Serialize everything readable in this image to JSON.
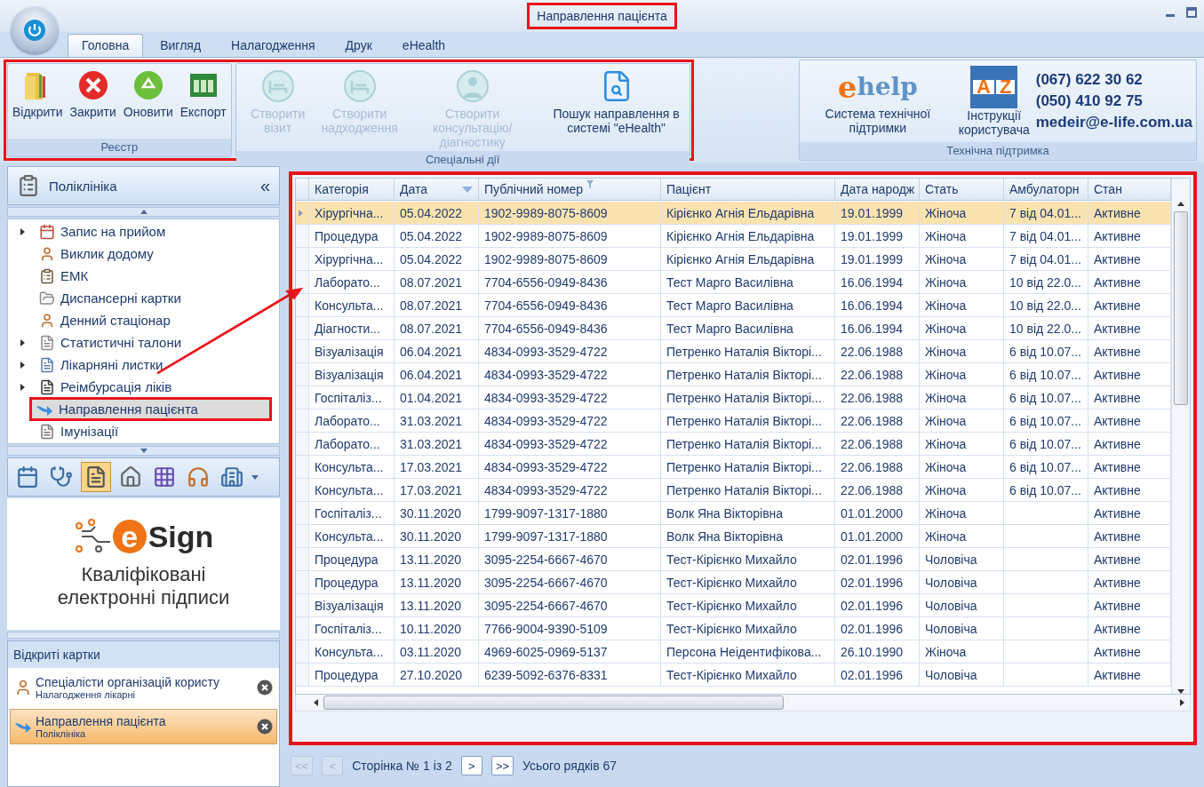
{
  "window": {
    "title": "Направлення пацієнта",
    "title_highlighted": true
  },
  "tabs": [
    {
      "label": "Головна",
      "selected": true
    },
    {
      "label": "Вигляд",
      "selected": false
    },
    {
      "label": "Налагодження",
      "selected": false
    },
    {
      "label": "Друк",
      "selected": false
    },
    {
      "label": "eHealth",
      "selected": false
    }
  ],
  "ribbon": {
    "highlighted": true,
    "groups": [
      {
        "title": "Реєстр",
        "buttons": [
          {
            "label": "Відкрити",
            "disabled": false
          },
          {
            "label": "Закрити",
            "disabled": false
          },
          {
            "label": "Оновити",
            "disabled": false
          },
          {
            "label": "Експорт",
            "disabled": false
          }
        ]
      },
      {
        "title": "Спеціальні дії",
        "buttons": [
          {
            "label": "Створити візит",
            "disabled": true
          },
          {
            "label": "Створити надходження",
            "disabled": true
          },
          {
            "label": "Створити консультацію/діагностику",
            "disabled": true
          },
          {
            "label": "Пошук направлення в системі \"eHealth\"",
            "disabled": false
          }
        ]
      }
    ]
  },
  "support": {
    "title": "Технічна підтримка",
    "help_logo": {
      "mark": "e",
      "text": "help"
    },
    "help_label": "Система технічної підтримки",
    "manual_letters": [
      "A",
      "Z"
    ],
    "manual_label": "Інструкції користувача",
    "phones": [
      "(067) 622 30 62",
      "(050) 410 92 75"
    ],
    "email": "medeir@e-life.com.ua"
  },
  "sidebar": {
    "title": "Поліклініка",
    "collapse": "«",
    "items": [
      {
        "label": "Запис на прийом",
        "has_children": true,
        "selected": false
      },
      {
        "label": "Виклик додому",
        "has_children": false,
        "selected": false
      },
      {
        "label": "ЕМК",
        "has_children": false,
        "selected": false
      },
      {
        "label": "Диспансерні картки",
        "has_children": false,
        "selected": false
      },
      {
        "label": "Денний стаціонар",
        "has_children": false,
        "selected": false
      },
      {
        "label": "Статистичні талони",
        "has_children": true,
        "selected": false
      },
      {
        "label": "Лікарняні листки",
        "has_children": true,
        "selected": false
      },
      {
        "label": "Реімбурсація ліків",
        "has_children": true,
        "selected": false
      },
      {
        "label": "Направлення пацієнта",
        "has_children": false,
        "selected": true,
        "highlighted": true
      },
      {
        "label": "Імунізації",
        "has_children": false,
        "selected": false
      }
    ],
    "modules": [
      {
        "selected": false
      },
      {
        "selected": false
      },
      {
        "selected": true
      },
      {
        "selected": false
      },
      {
        "selected": false
      },
      {
        "selected": false
      },
      {
        "selected": false
      }
    ]
  },
  "banner": {
    "logo": "Sign",
    "logo_mark": "e",
    "caption": "Кваліфіковані електронні підписи"
  },
  "open_cards": {
    "title": "Відкриті картки",
    "items": [
      {
        "title": "Спеціалісти організацій користу",
        "subtitle": "Налагодження лікарні",
        "selected": false
      },
      {
        "title": "Направлення пацієнта",
        "subtitle": "Поліклініка",
        "selected": true
      }
    ]
  },
  "table": {
    "highlighted": true,
    "columns": [
      {
        "label": "Категорія"
      },
      {
        "label": "Дата",
        "sorted": true
      },
      {
        "label": "Публічний номер",
        "filtered": true
      },
      {
        "label": "Пацієнт"
      },
      {
        "label": "Дата народж"
      },
      {
        "label": "Стать"
      },
      {
        "label": "Амбулаторн"
      },
      {
        "label": "Стан"
      }
    ],
    "rows": [
      {
        "selected": true,
        "cells": [
          "Хірургічна...",
          "05.04.2022",
          "1902-9989-8075-8609",
          "Кірієнко Агнія Ельдарівна",
          "19.01.1999",
          "Жіноча",
          "7 від 04.01...",
          "Активне"
        ]
      },
      {
        "selected": false,
        "cells": [
          "Процедура",
          "05.04.2022",
          "1902-9989-8075-8609",
          "Кірієнко Агнія Ельдарівна",
          "19.01.1999",
          "Жіноча",
          "7 від 04.01...",
          "Активне"
        ]
      },
      {
        "selected": false,
        "cells": [
          "Хірургічна...",
          "05.04.2022",
          "1902-9989-8075-8609",
          "Кірієнко Агнія Ельдарівна",
          "19.01.1999",
          "Жіноча",
          "7 від 04.01...",
          "Активне"
        ]
      },
      {
        "selected": false,
        "cells": [
          "Лаборато...",
          "08.07.2021",
          "7704-6556-0949-8436",
          "Тест Марго Василівна",
          "16.06.1994",
          "Жіноча",
          "10 від 22.0...",
          "Активне"
        ]
      },
      {
        "selected": false,
        "cells": [
          "Консульта...",
          "08.07.2021",
          "7704-6556-0949-8436",
          "Тест Марго Василівна",
          "16.06.1994",
          "Жіноча",
          "10 від 22.0...",
          "Активне"
        ]
      },
      {
        "selected": false,
        "cells": [
          "Діагности...",
          "08.07.2021",
          "7704-6556-0949-8436",
          "Тест Марго Василівна",
          "16.06.1994",
          "Жіноча",
          "10 від 22.0...",
          "Активне"
        ]
      },
      {
        "selected": false,
        "cells": [
          "Візуалізація",
          "06.04.2021",
          "4834-0993-3529-4722",
          "Петренко Наталія Вікторі...",
          "22.06.1988",
          "Жіноча",
          "6 від 10.07...",
          "Активне"
        ]
      },
      {
        "selected": false,
        "cells": [
          "Візуалізація",
          "06.04.2021",
          "4834-0993-3529-4722",
          "Петренко Наталія Вікторі...",
          "22.06.1988",
          "Жіноча",
          "6 від 10.07...",
          "Активне"
        ]
      },
      {
        "selected": false,
        "cells": [
          "Госпіталіз...",
          "01.04.2021",
          "4834-0993-3529-4722",
          "Петренко Наталія Вікторі...",
          "22.06.1988",
          "Жіноча",
          "6 від 10.07...",
          "Активне"
        ]
      },
      {
        "selected": false,
        "cells": [
          "Лаборато...",
          "31.03.2021",
          "4834-0993-3529-4722",
          "Петренко Наталія Вікторі...",
          "22.06.1988",
          "Жіноча",
          "6 від 10.07...",
          "Активне"
        ]
      },
      {
        "selected": false,
        "cells": [
          "Лаборато...",
          "31.03.2021",
          "4834-0993-3529-4722",
          "Петренко Наталія Вікторі...",
          "22.06.1988",
          "Жіноча",
          "6 від 10.07...",
          "Активне"
        ]
      },
      {
        "selected": false,
        "cells": [
          "Консульта...",
          "17.03.2021",
          "4834-0993-3529-4722",
          "Петренко Наталія Вікторі...",
          "22.06.1988",
          "Жіноча",
          "6 від 10.07...",
          "Активне"
        ]
      },
      {
        "selected": false,
        "cells": [
          "Консульта...",
          "17.03.2021",
          "4834-0993-3529-4722",
          "Петренко Наталія Вікторі...",
          "22.06.1988",
          "Жіноча",
          "6 від 10.07...",
          "Активне"
        ]
      },
      {
        "selected": false,
        "cells": [
          "Госпіталіз...",
          "30.11.2020",
          "1799-9097-1317-1880",
          "Волк Яна Вікторівна",
          "01.01.2000",
          "Жіноча",
          "",
          "Активне"
        ]
      },
      {
        "selected": false,
        "cells": [
          "Консульта...",
          "30.11.2020",
          "1799-9097-1317-1880",
          "Волк Яна Вікторівна",
          "01.01.2000",
          "Жіноча",
          "",
          "Активне"
        ]
      },
      {
        "selected": false,
        "cells": [
          "Процедура",
          "13.11.2020",
          "3095-2254-6667-4670",
          "Тест-Кірієнко Михайло",
          "02.01.1996",
          "Чоловіча",
          "",
          "Активне"
        ]
      },
      {
        "selected": false,
        "cells": [
          "Процедура",
          "13.11.2020",
          "3095-2254-6667-4670",
          "Тест-Кірієнко Михайло",
          "02.01.1996",
          "Чоловіча",
          "",
          "Активне"
        ]
      },
      {
        "selected": false,
        "cells": [
          "Візуалізація",
          "13.11.2020",
          "3095-2254-6667-4670",
          "Тест-Кірієнко Михайло",
          "02.01.1996",
          "Чоловіча",
          "",
          "Активне"
        ]
      },
      {
        "selected": false,
        "cells": [
          "Госпіталіз...",
          "10.11.2020",
          "7766-9004-9390-5109",
          "Тест-Кірієнко Михайло",
          "02.01.1996",
          "Чоловіча",
          "",
          "Активне"
        ]
      },
      {
        "selected": false,
        "cells": [
          "Консульта...",
          "03.11.2020",
          "4969-6025-0969-5137",
          "Персона Неідентифікова...",
          "26.10.1990",
          "Жіноча",
          "",
          "Активне"
        ]
      },
      {
        "selected": false,
        "cells": [
          "Процедура",
          "27.10.2020",
          "6239-5092-6376-8331",
          "Тест-Кірієнко Михайло",
          "02.01.1996",
          "Чоловіча",
          "",
          "Активне"
        ]
      }
    ]
  },
  "pager": {
    "buttons": [
      {
        "label": "<<",
        "disabled": true
      },
      {
        "label": "<",
        "disabled": true
      },
      {
        "label": ">",
        "disabled": false
      },
      {
        "label": ">>",
        "disabled": false
      }
    ],
    "page_text": "Сторінка № 1 із 2",
    "total_text": "Усього рядків 67"
  }
}
